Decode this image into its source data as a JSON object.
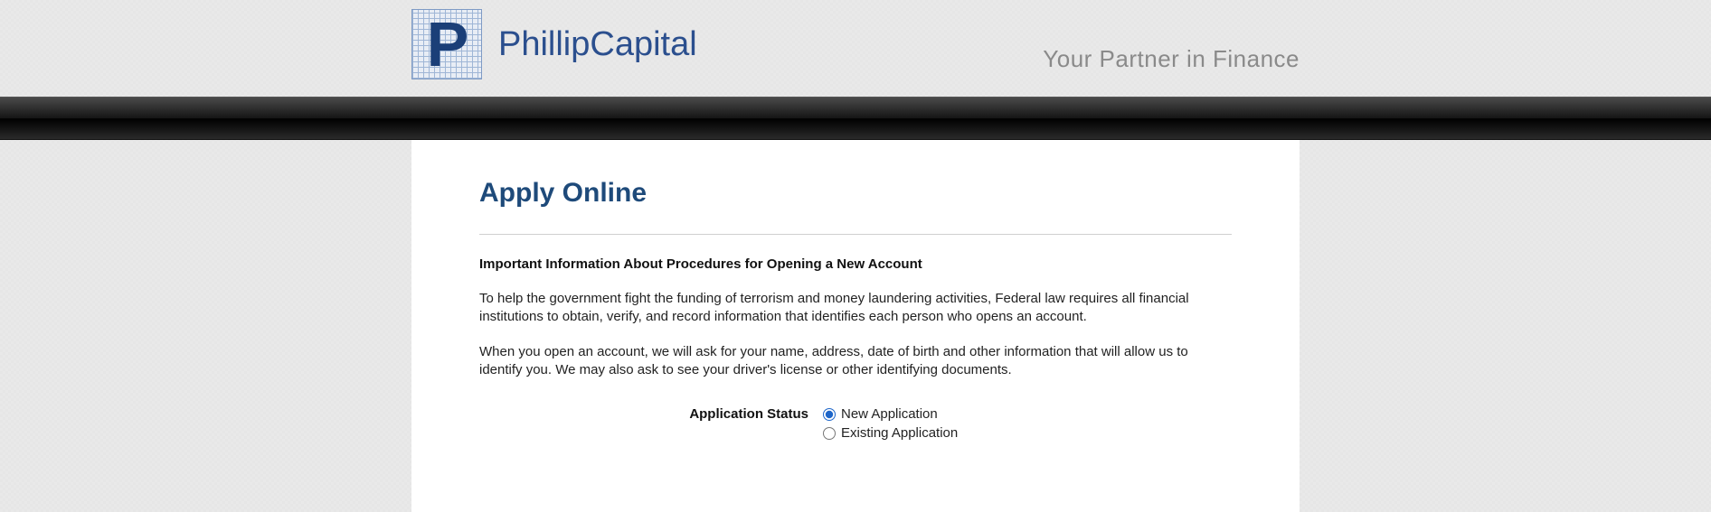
{
  "header": {
    "logo_letter": "P",
    "brand_text": "PhillipCapital",
    "tagline": "Your Partner in Finance"
  },
  "page": {
    "title": "Apply Online",
    "notice_heading": "Important Information About Procedures for Opening a New Account",
    "notice_para1": "To help the government fight the funding of terrorism and money laundering activities, Federal law requires all financial institutions to obtain, verify, and record information that identifies each person who opens an account.",
    "notice_para2": "When you open an account, we will ask for your name, address, date of birth and other information that will allow us to identify you. We may also ask to see your driver's license or other identifying documents."
  },
  "form": {
    "application_status_label": "Application Status",
    "options": {
      "new": "New Application",
      "existing": "Existing Application"
    },
    "selected": "new"
  }
}
